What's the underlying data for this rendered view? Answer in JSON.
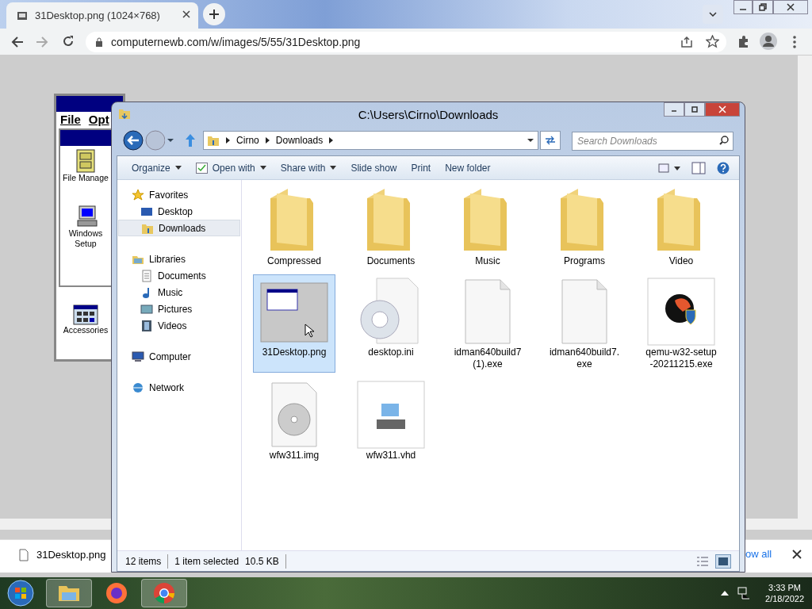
{
  "browser": {
    "tab_title": "31Desktop.png (1024×768)",
    "url": "computernewb.com/w/images/5/55/31Desktop.png"
  },
  "win31": {
    "menu": [
      "File",
      "Opt"
    ],
    "icons": [
      {
        "kind": "cabinet",
        "label": "File Manage"
      },
      {
        "kind": "setup",
        "label": "Windows Setup"
      },
      {
        "kind": "accessories",
        "label": "Accessories"
      }
    ]
  },
  "explorer": {
    "title": "C:\\Users\\Cirno\\Downloads",
    "breadcrumb": [
      "Cirno",
      "Downloads"
    ],
    "search": {
      "placeholder": "Search Downloads"
    },
    "toolbar": [
      {
        "label": "Organize",
        "dropdown": true,
        "check": false
      },
      {
        "label": "Open with",
        "dropdown": true,
        "check": true
      },
      {
        "label": "Share with",
        "dropdown": true,
        "check": false
      },
      {
        "label": "Slide show",
        "dropdown": false,
        "check": false
      },
      {
        "label": "Print",
        "dropdown": false,
        "check": false
      },
      {
        "label": "New folder",
        "dropdown": false,
        "check": false
      }
    ],
    "nav": [
      {
        "label": "Favorites",
        "kind": "star",
        "selected": false,
        "children": [
          {
            "label": "Desktop",
            "kind": "desktop",
            "selected": false
          },
          {
            "label": "Downloads",
            "kind": "downloads",
            "selected": true
          }
        ]
      },
      {
        "label": "Libraries",
        "kind": "libraries",
        "selected": false,
        "children": [
          {
            "label": "Documents",
            "kind": "document",
            "selected": false
          },
          {
            "label": "Music",
            "kind": "music",
            "selected": false
          },
          {
            "label": "Pictures",
            "kind": "pictures",
            "selected": false
          },
          {
            "label": "Videos",
            "kind": "videos",
            "selected": false
          }
        ]
      },
      {
        "label": "Computer",
        "kind": "computer",
        "selected": false
      },
      {
        "label": "Network",
        "kind": "network",
        "selected": false
      }
    ],
    "items": [
      {
        "kind": "folder",
        "name": "Compressed",
        "selected": false
      },
      {
        "kind": "folder",
        "name": "Documents",
        "selected": false
      },
      {
        "kind": "folder",
        "name": "Music",
        "selected": false
      },
      {
        "kind": "folder",
        "name": "Programs",
        "selected": false
      },
      {
        "kind": "folder",
        "name": "Video",
        "selected": false
      },
      {
        "kind": "thumbnail",
        "name": "31Desktop.png",
        "selected": true
      },
      {
        "kind": "settings",
        "name": "desktop.ini",
        "selected": false
      },
      {
        "kind": "blank",
        "name": "idman640build7 (1).exe",
        "selected": false
      },
      {
        "kind": "blank",
        "name": "idman640build7. exe",
        "selected": false
      },
      {
        "kind": "installer",
        "name": "qemu-w32-setup -20211215.exe",
        "selected": false
      },
      {
        "kind": "disc",
        "name": "wfw311.img",
        "selected": false
      },
      {
        "kind": "drive",
        "name": "wfw311.vhd",
        "selected": false
      }
    ],
    "status": [
      "12 items",
      "1 item selected",
      "10.5 KB"
    ]
  },
  "download_bar": {
    "file": "31Desktop.png",
    "show_all": "ow all"
  },
  "taskbar": {
    "time": "3:33 PM",
    "date": "2/18/2022",
    "apps": [
      {
        "kind": "explorer",
        "selected": true
      },
      {
        "kind": "firefox",
        "selected": false
      },
      {
        "kind": "chrome",
        "selected": true
      }
    ]
  }
}
